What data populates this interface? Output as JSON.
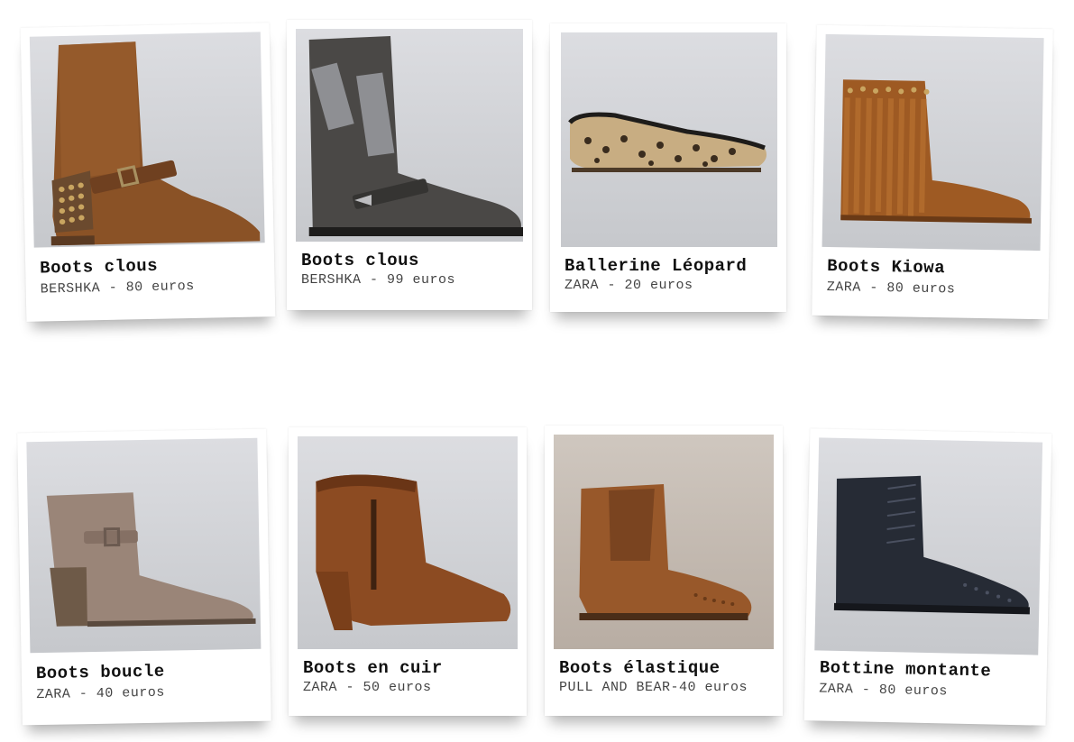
{
  "products": [
    {
      "title": "Boots clous",
      "subtitle": "BERSHKA - 80 euros",
      "image": "brown-suede-studded-boot"
    },
    {
      "title": "Boots clous",
      "subtitle": "BERSHKA - 99 euros",
      "image": "grey-studded-biker-boot"
    },
    {
      "title": "Ballerine Léopard",
      "subtitle": "ZARA - 20 euros",
      "image": "leopard-ballet-flat"
    },
    {
      "title": "Boots Kiowa",
      "subtitle": "ZARA - 80 euros",
      "image": "fringe-moccasin-boot"
    },
    {
      "title": "Boots boucle",
      "subtitle": "ZARA - 40 euros",
      "image": "taupe-heeled-ankle-boot"
    },
    {
      "title": "Boots en cuir",
      "subtitle": "ZARA - 50 euros",
      "image": "tan-leather-heeled-bootie"
    },
    {
      "title": "Boots élastique",
      "subtitle": "PULL AND BEAR-40 euros",
      "image": "brown-chelsea-boot"
    },
    {
      "title": "Bottine montante",
      "subtitle": "ZARA - 80 euros",
      "image": "black-lace-up-brogue-boot"
    }
  ]
}
